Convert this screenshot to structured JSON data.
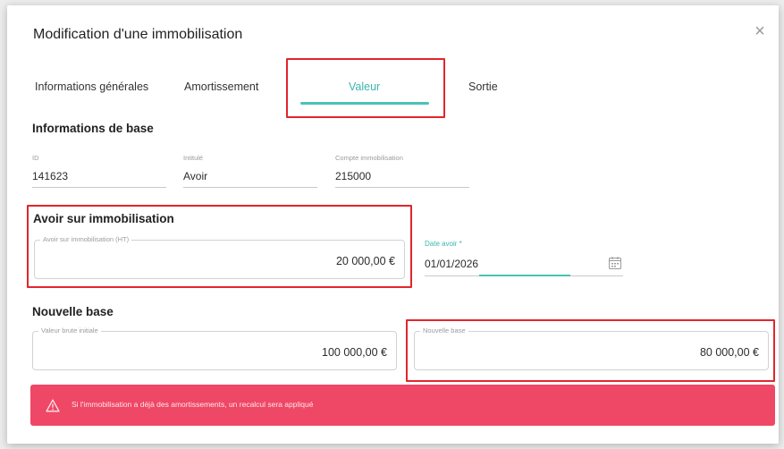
{
  "modal": {
    "title": "Modification d'une immobilisation",
    "close_symbol": "×"
  },
  "tabs": [
    {
      "label": "Informations générales"
    },
    {
      "label": "Amortissement"
    },
    {
      "label": "Valeur",
      "active": true
    },
    {
      "label": "Sortie"
    }
  ],
  "base_info": {
    "section_title": "Informations de base",
    "fields": [
      {
        "label": "ID",
        "value": "141623"
      },
      {
        "label": "Intitulé",
        "value": "Avoir"
      },
      {
        "label": "Compte immobilisation",
        "value": "215000"
      }
    ]
  },
  "avoir": {
    "section_title": "Avoir sur immobilisation",
    "amount_label": "Avoir sur immobilisation (HT)",
    "amount_value": "20 000,00 €",
    "date_label": "Date avoir *",
    "date_value": "01/01/2026"
  },
  "nouvelle_base": {
    "section_title": "Nouvelle base",
    "initial_label": "Valeur brute initiale",
    "initial_value": "100 000,00 €",
    "new_label": "Nouvelle base",
    "new_value": "80 000,00 €"
  },
  "alert": {
    "message": "Si l'immobilisation a déjà des amortissements, un recalcul sera appliqué"
  },
  "colors": {
    "accent": "#49c2b7",
    "highlight": "#e0262c",
    "alert_bg": "#ef4766"
  }
}
